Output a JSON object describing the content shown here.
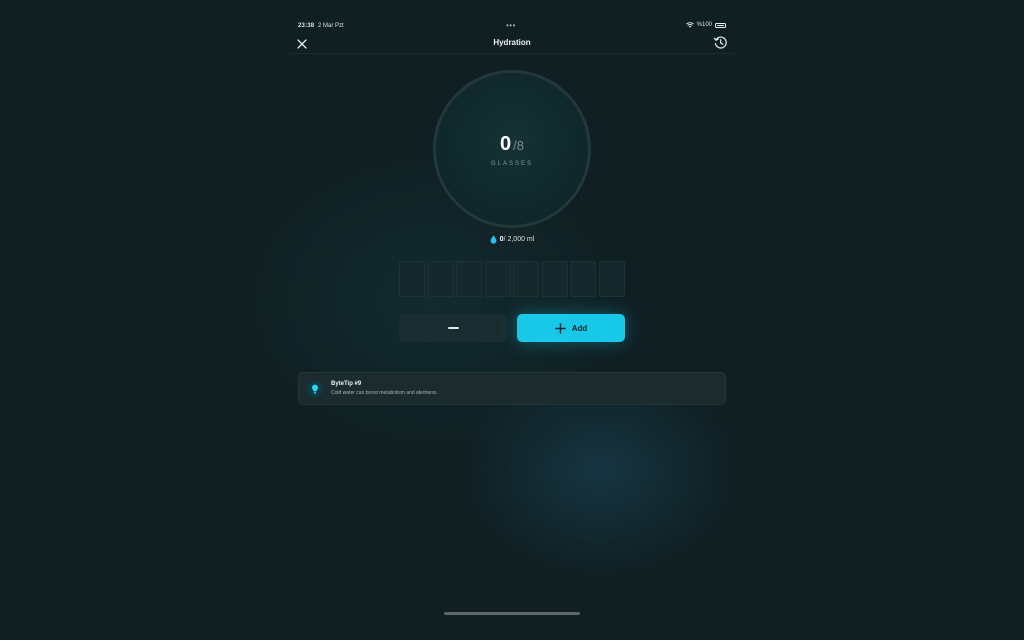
{
  "status_bar": {
    "time": "23:38",
    "date": "2 Mar Pzt",
    "dots": "•••",
    "battery_label": "%100"
  },
  "header": {
    "title": "Hydration",
    "close_icon": "close-icon",
    "history_icon": "history-icon"
  },
  "progress": {
    "current": "0",
    "separator": "/",
    "goal": "8",
    "unit": "GLASSES"
  },
  "volume": {
    "current": "0",
    "rest": "/ 2,000 ml",
    "icon": "water-drop-icon"
  },
  "glasses": {
    "total": 8,
    "filled": 0
  },
  "buttons": {
    "decrease_icon": "minus-icon",
    "add_label": "Add",
    "add_icon": "plus-icon"
  },
  "tip": {
    "title": "ByteTip #9",
    "text": "Cold water can boost metabolism and alertness.",
    "icon": "lightbulb-icon"
  },
  "colors": {
    "accent": "#18c8e8",
    "background": "#0f1f22",
    "card": "#1b2b2e"
  }
}
